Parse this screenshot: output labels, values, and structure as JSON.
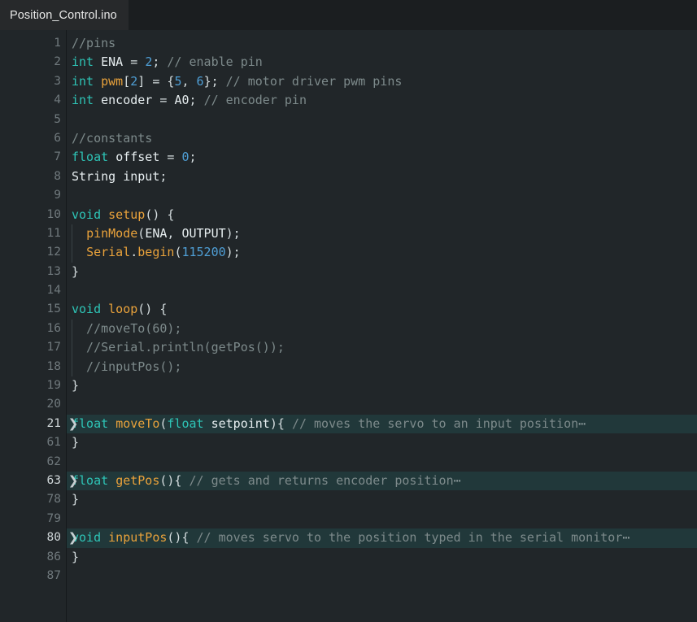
{
  "window": {
    "kind": "code-editor"
  },
  "tab_bar": {
    "tabs": [
      {
        "label": "Position_Control.ino",
        "active": true
      }
    ]
  },
  "colors": {
    "tab_bar_background": "#1b1e20",
    "active_tab_background": "#27292b",
    "editor_background": "#212629",
    "gutter_text": "#70797d",
    "active_line_number": "#cfd6d8",
    "folded_region_highlight": "#21383a",
    "keyword": "#2ec4b6",
    "function": "#e9a23b",
    "number": "#4f9fd6",
    "identifier": "#e7eef0",
    "comment": "#7d8a8b",
    "punctuation": "#d6dee0"
  },
  "editor": {
    "fold_icon": "❯",
    "fold_ellipsis": "⋯",
    "lines": [
      {
        "num": "1",
        "folded": false,
        "indent": 0,
        "tokens": [
          {
            "t": "//pins",
            "c": "com"
          }
        ]
      },
      {
        "num": "2",
        "folded": false,
        "indent": 0,
        "tokens": [
          {
            "t": "int",
            "c": "kw"
          },
          {
            "t": " ",
            "c": "pun"
          },
          {
            "t": "ENA",
            "c": "id"
          },
          {
            "t": " = ",
            "c": "pun"
          },
          {
            "t": "2",
            "c": "num"
          },
          {
            "t": "; ",
            "c": "pun"
          },
          {
            "t": "// enable pin",
            "c": "com"
          }
        ]
      },
      {
        "num": "3",
        "folded": false,
        "indent": 0,
        "tokens": [
          {
            "t": "int",
            "c": "kw"
          },
          {
            "t": " ",
            "c": "pun"
          },
          {
            "t": "pwm",
            "c": "fn"
          },
          {
            "t": "[",
            "c": "pun"
          },
          {
            "t": "2",
            "c": "num"
          },
          {
            "t": "] = {",
            "c": "pun"
          },
          {
            "t": "5",
            "c": "num"
          },
          {
            "t": ", ",
            "c": "pun"
          },
          {
            "t": "6",
            "c": "num"
          },
          {
            "t": "}; ",
            "c": "pun"
          },
          {
            "t": "// motor driver pwm pins",
            "c": "com"
          }
        ]
      },
      {
        "num": "4",
        "folded": false,
        "indent": 0,
        "tokens": [
          {
            "t": "int",
            "c": "kw"
          },
          {
            "t": " ",
            "c": "pun"
          },
          {
            "t": "encoder",
            "c": "id"
          },
          {
            "t": " = ",
            "c": "pun"
          },
          {
            "t": "A0",
            "c": "id"
          },
          {
            "t": "; ",
            "c": "pun"
          },
          {
            "t": "// encoder pin",
            "c": "com"
          }
        ]
      },
      {
        "num": "5",
        "folded": false,
        "indent": 0,
        "tokens": []
      },
      {
        "num": "6",
        "folded": false,
        "indent": 0,
        "tokens": [
          {
            "t": "//constants",
            "c": "com"
          }
        ]
      },
      {
        "num": "7",
        "folded": false,
        "indent": 0,
        "tokens": [
          {
            "t": "float",
            "c": "kw"
          },
          {
            "t": " ",
            "c": "pun"
          },
          {
            "t": "offset",
            "c": "id"
          },
          {
            "t": " = ",
            "c": "pun"
          },
          {
            "t": "0",
            "c": "num"
          },
          {
            "t": ";",
            "c": "pun"
          }
        ]
      },
      {
        "num": "8",
        "folded": false,
        "indent": 0,
        "tokens": [
          {
            "t": "String",
            "c": "id"
          },
          {
            "t": " ",
            "c": "pun"
          },
          {
            "t": "input",
            "c": "id"
          },
          {
            "t": ";",
            "c": "pun"
          }
        ]
      },
      {
        "num": "9",
        "folded": false,
        "indent": 0,
        "tokens": []
      },
      {
        "num": "10",
        "folded": false,
        "indent": 0,
        "tokens": [
          {
            "t": "void",
            "c": "kw"
          },
          {
            "t": " ",
            "c": "pun"
          },
          {
            "t": "setup",
            "c": "fn"
          },
          {
            "t": "() {",
            "c": "pun"
          }
        ]
      },
      {
        "num": "11",
        "folded": false,
        "indent": 1,
        "tokens": [
          {
            "t": "  ",
            "c": "pun"
          },
          {
            "t": "pinMode",
            "c": "fn"
          },
          {
            "t": "(",
            "c": "pun"
          },
          {
            "t": "ENA",
            "c": "id"
          },
          {
            "t": ", ",
            "c": "pun"
          },
          {
            "t": "OUTPUT",
            "c": "id"
          },
          {
            "t": ");",
            "c": "pun"
          }
        ]
      },
      {
        "num": "12",
        "folded": false,
        "indent": 1,
        "tokens": [
          {
            "t": "  ",
            "c": "pun"
          },
          {
            "t": "Serial",
            "c": "fn"
          },
          {
            "t": ".",
            "c": "pun"
          },
          {
            "t": "begin",
            "c": "fn"
          },
          {
            "t": "(",
            "c": "pun"
          },
          {
            "t": "115200",
            "c": "num"
          },
          {
            "t": ");",
            "c": "pun"
          }
        ]
      },
      {
        "num": "13",
        "folded": false,
        "indent": 0,
        "tokens": [
          {
            "t": "}",
            "c": "pun"
          }
        ]
      },
      {
        "num": "14",
        "folded": false,
        "indent": 0,
        "tokens": []
      },
      {
        "num": "15",
        "folded": false,
        "indent": 0,
        "tokens": [
          {
            "t": "void",
            "c": "kw"
          },
          {
            "t": " ",
            "c": "pun"
          },
          {
            "t": "loop",
            "c": "fn"
          },
          {
            "t": "() {",
            "c": "pun"
          }
        ]
      },
      {
        "num": "16",
        "folded": false,
        "indent": 1,
        "tokens": [
          {
            "t": "  //moveTo(60);",
            "c": "com"
          }
        ]
      },
      {
        "num": "17",
        "folded": false,
        "indent": 1,
        "tokens": [
          {
            "t": "  //Serial.println(getPos());",
            "c": "com"
          }
        ]
      },
      {
        "num": "18",
        "folded": false,
        "indent": 1,
        "tokens": [
          {
            "t": "  //inputPos();",
            "c": "com"
          }
        ]
      },
      {
        "num": "19",
        "folded": false,
        "indent": 0,
        "tokens": [
          {
            "t": "}",
            "c": "pun"
          }
        ]
      },
      {
        "num": "20",
        "folded": false,
        "indent": 0,
        "tokens": []
      },
      {
        "num": "21",
        "folded": true,
        "indent": 0,
        "tokens": [
          {
            "t": "float",
            "c": "kw"
          },
          {
            "t": " ",
            "c": "pun"
          },
          {
            "t": "moveTo",
            "c": "fn"
          },
          {
            "t": "(",
            "c": "pun"
          },
          {
            "t": "float",
            "c": "kw"
          },
          {
            "t": " ",
            "c": "pun"
          },
          {
            "t": "setpoint",
            "c": "id"
          },
          {
            "t": "){ ",
            "c": "pun"
          },
          {
            "t": "// moves the servo to an input position",
            "c": "com"
          },
          {
            "t": "⋯",
            "c": "ell"
          }
        ]
      },
      {
        "num": "61",
        "folded": false,
        "indent": 0,
        "tokens": [
          {
            "t": "}",
            "c": "pun"
          }
        ]
      },
      {
        "num": "62",
        "folded": false,
        "indent": 0,
        "tokens": []
      },
      {
        "num": "63",
        "folded": true,
        "indent": 0,
        "tokens": [
          {
            "t": "float",
            "c": "kw"
          },
          {
            "t": " ",
            "c": "pun"
          },
          {
            "t": "getPos",
            "c": "fn"
          },
          {
            "t": "(){ ",
            "c": "pun"
          },
          {
            "t": "// gets and returns encoder position",
            "c": "com"
          },
          {
            "t": "⋯",
            "c": "ell"
          }
        ]
      },
      {
        "num": "78",
        "folded": false,
        "indent": 0,
        "tokens": [
          {
            "t": "}",
            "c": "pun"
          }
        ]
      },
      {
        "num": "79",
        "folded": false,
        "indent": 0,
        "tokens": []
      },
      {
        "num": "80",
        "folded": true,
        "indent": 0,
        "tokens": [
          {
            "t": "void",
            "c": "kw"
          },
          {
            "t": " ",
            "c": "pun"
          },
          {
            "t": "inputPos",
            "c": "fn"
          },
          {
            "t": "(){ ",
            "c": "pun"
          },
          {
            "t": "// moves servo to the position typed in the serial monitor",
            "c": "com"
          },
          {
            "t": "⋯",
            "c": "ell"
          }
        ]
      },
      {
        "num": "86",
        "folded": false,
        "indent": 0,
        "tokens": [
          {
            "t": "}",
            "c": "pun"
          }
        ]
      },
      {
        "num": "87",
        "folded": false,
        "indent": 0,
        "tokens": []
      }
    ]
  }
}
